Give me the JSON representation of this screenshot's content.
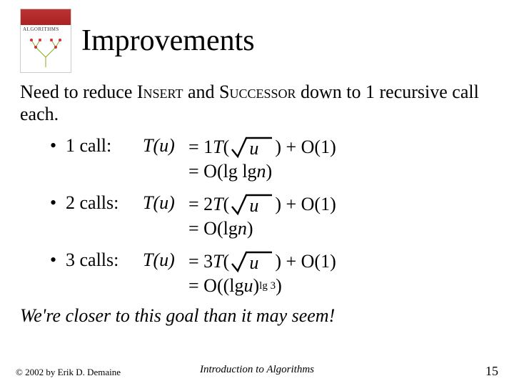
{
  "header": {
    "title": "Improvements",
    "thumb_label": "ALGORITHMS"
  },
  "intro": {
    "pre": "Need to reduce ",
    "w1": "Insert",
    "mid": " and ",
    "w2": "Successor",
    "post": " down to 1 recursive call each."
  },
  "rows": [
    {
      "lead": "1 call:",
      "tu_pre": "T",
      "tu_arg": "u",
      "eq1_pre": "= 1 ",
      "eq1_T": "T",
      "eq1_paren": "(",
      "sqrt_arg": "u",
      "eq1_post": " ) + O(1)",
      "eq2": "= O(lg lg ",
      "eq2_var": "n",
      "eq2_end": ")"
    },
    {
      "lead": "2 calls:",
      "tu_pre": "T",
      "tu_arg": "u",
      "eq1_pre": "= 2 ",
      "eq1_T": "T",
      "eq1_paren": "(",
      "sqrt_arg": "u",
      "eq1_post": " ) + O(1)",
      "eq2": "= O(lg ",
      "eq2_var": "n",
      "eq2_end": ")"
    },
    {
      "lead": "3 calls:",
      "tu_pre": "T",
      "tu_arg": "u",
      "eq1_pre": "= 3 ",
      "eq1_T": "T",
      "eq1_paren": "(",
      "sqrt_arg": "u",
      "eq1_post": " ) + O(1)",
      "eq2": "= O((lg ",
      "eq2_var": "u",
      "eq2_mid": ") ",
      "eq2_sup": "lg 3",
      "eq2_end": ")"
    }
  ],
  "closer": "We're closer to this goal than it may seem!",
  "footer": {
    "left": "© 2002 by Erik D. Demaine",
    "center": "Introduction to Algorithms",
    "right": "15"
  }
}
